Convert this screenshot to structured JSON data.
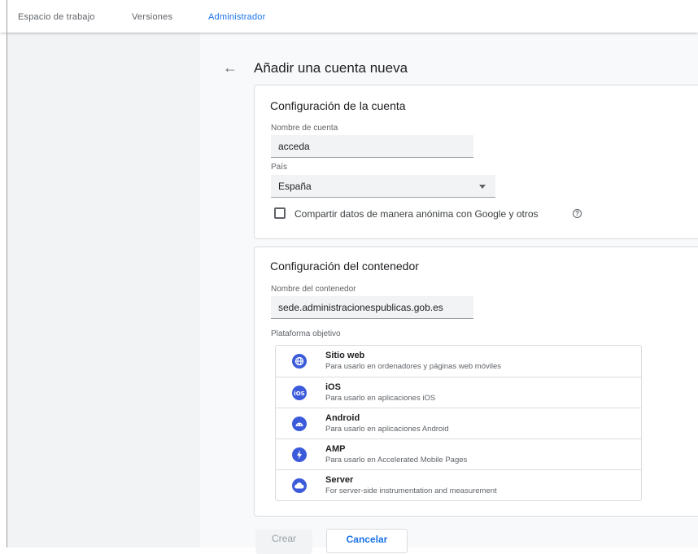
{
  "nav": {
    "tabs": [
      {
        "label": "Espacio de trabajo",
        "active": false
      },
      {
        "label": "Versiones",
        "active": false
      },
      {
        "label": "Administrador",
        "active": true
      }
    ]
  },
  "page": {
    "title": "Añadir una cuenta nueva"
  },
  "account_config": {
    "title": "Configuración de la cuenta",
    "name_label": "Nombre de cuenta",
    "name_value": "acceda",
    "country_label": "País",
    "country_value": "España",
    "share_label": "Compartir datos de manera anónima con Google y otros",
    "share_checked": false,
    "help_icon": "help-circle-icon"
  },
  "container_config": {
    "title": "Configuración del contenedor",
    "name_label": "Nombre del contenedor",
    "name_value": "sede.administracionespublicas.gob.es",
    "platform_label": "Plataforma objetivo",
    "platforms": [
      {
        "icon": "globe-icon",
        "name": "Sitio web",
        "desc": "Para usarlo en ordenadores y páginas web móviles"
      },
      {
        "icon": "ios-icon",
        "name": "iOS",
        "desc": "Para usarlo en aplicaciones iOS"
      },
      {
        "icon": "android-icon",
        "name": "Android",
        "desc": "Para usarlo en aplicaciones Android"
      },
      {
        "icon": "amp-icon",
        "name": "AMP",
        "desc": "Para usarlo en Accelerated Mobile Pages"
      },
      {
        "icon": "server-icon",
        "name": "Server",
        "desc": "For server-side instrumentation and measurement"
      }
    ]
  },
  "actions": {
    "create_label": "Crear",
    "cancel_label": "Cancelar"
  },
  "colors": {
    "accent": "#1a73e8",
    "platform_icon": "#3b5bdb"
  }
}
